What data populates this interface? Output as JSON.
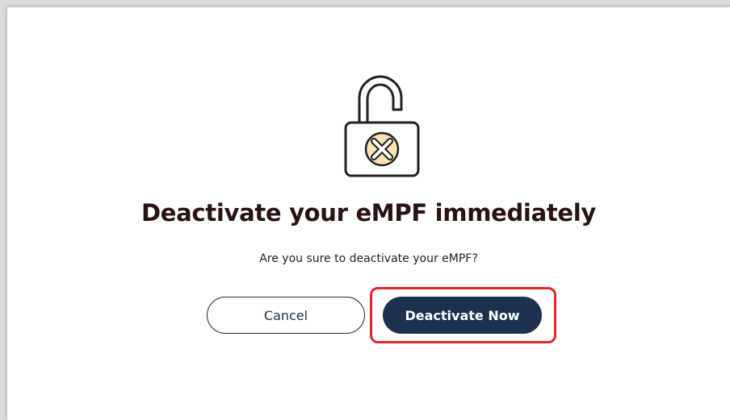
{
  "dialog": {
    "icon": "unlocked-padlock-with-x-icon",
    "title": "Deactivate your eMPF immediately",
    "message": "Are you sure to deactivate your eMPF?",
    "cancel_label": "Cancel",
    "confirm_label": "Deactivate Now"
  },
  "colors": {
    "primary": "#1d3050",
    "title": "#2a1212",
    "icon_fill": "#fbe3b3",
    "highlight": "#e0262d"
  }
}
